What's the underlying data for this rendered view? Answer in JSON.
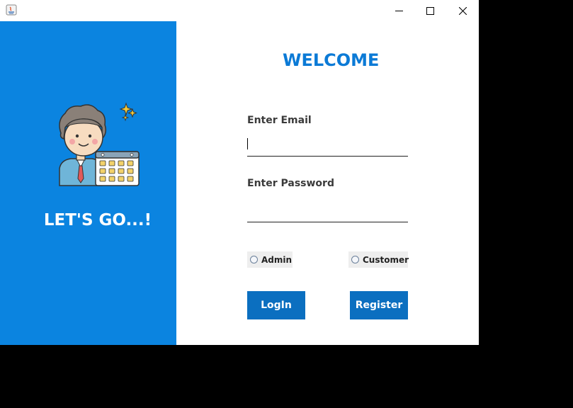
{
  "window": {
    "controls": {
      "minimize": "—",
      "maximize": "☐",
      "close": "✕"
    }
  },
  "left": {
    "tagline": "LET'S GO...!",
    "avatar_icon": "person-with-calendar-icon"
  },
  "form": {
    "title": "WELCOME",
    "email_label": "Enter Email",
    "email_value": "",
    "password_label": "Enter Password",
    "password_value": "",
    "roles": [
      {
        "label": "Admin",
        "selected": false
      },
      {
        "label": "Customer",
        "selected": false
      }
    ],
    "login_label": "LogIn",
    "register_label": "Register"
  },
  "colors": {
    "left_panel": "#0b84e0",
    "title": "#0b7ad6",
    "button": "#0b6fc0"
  }
}
